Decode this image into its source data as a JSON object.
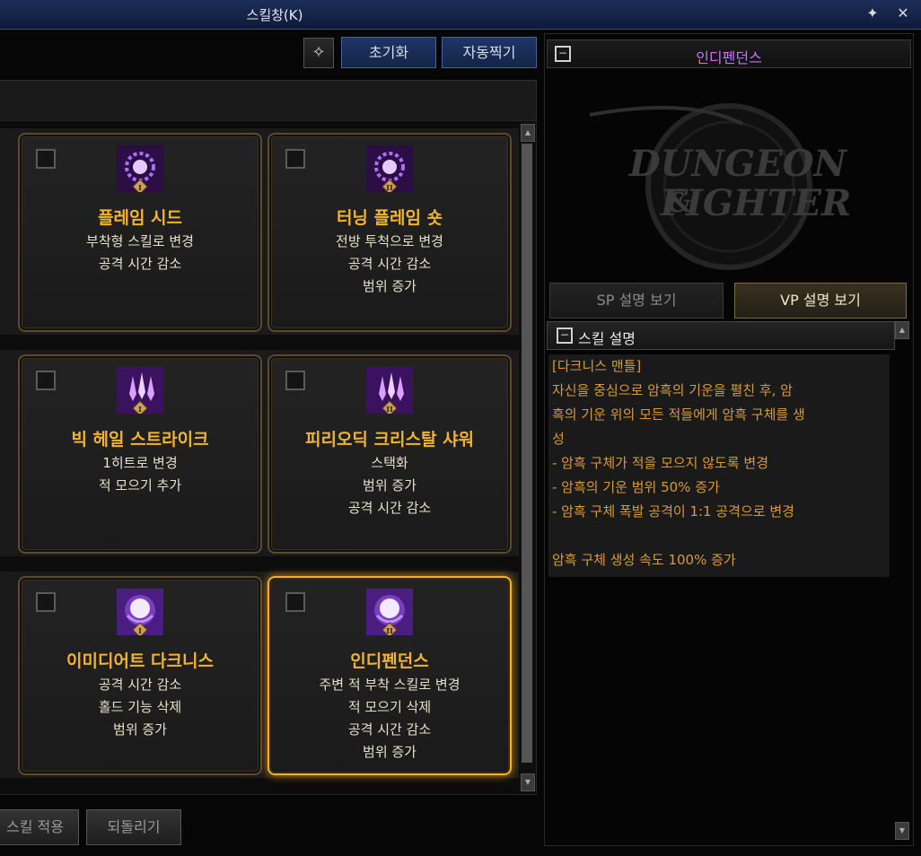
{
  "window": {
    "title": "스킬창(K)"
  },
  "toolbar": {
    "reset_label": "초기화",
    "auto_label": "자동찍기"
  },
  "skills": [
    {
      "name": "플레임 시드",
      "tier": "I",
      "lines": [
        "부착형 스킬로 변경",
        "공격 시간 감소"
      ],
      "icon": "dark-ring-icon"
    },
    {
      "name": "터닝 플레임 숏",
      "tier": "II",
      "lines": [
        "전방 투척으로 변경",
        "공격 시간 감소",
        "범위 증가"
      ],
      "icon": "dark-ring-icon"
    },
    {
      "name": "빅 헤일 스트라이크",
      "tier": "I",
      "lines": [
        "1히트로 변경",
        "적 모으기 추가"
      ],
      "icon": "crystal-shard-icon"
    },
    {
      "name": "피리오딕 크리스탈 샤워",
      "tier": "II",
      "lines": [
        "스택화",
        "범위 증가",
        "공격 시간 감소"
      ],
      "icon": "crystal-shard-icon"
    },
    {
      "name": "이미디어트 다크니스",
      "tier": "I",
      "lines": [
        "공격 시간 감소",
        "홀드 기능 삭제",
        "범위 증가"
      ],
      "icon": "dark-orb-icon"
    },
    {
      "name": "인디펜던스",
      "tier": "II",
      "lines": [
        "주변 적 부착 스킬로 변경",
        "적 모으기 삭제",
        "공격 시간 감소",
        "범위 증가"
      ],
      "icon": "dark-orb-icon",
      "selected": true
    }
  ],
  "bottom": {
    "apply_label": "스킬 적용",
    "revert_label": "되돌리기"
  },
  "right": {
    "header": "인디펜던스",
    "tab_sp": "SP 설명 보기",
    "tab_vp": "VP 설명 보기",
    "desc_header": "스킬 설명",
    "desc_lines": [
      "[다크니스 맨틀]",
      "자신을 중심으로 암흑의 기운을 펼친 후, 암",
      "흑의 기운 위의 모든 적들에게 암흑 구체를 생",
      "성",
      " - 암흑 구체가 적을 모으지 않도록 변경",
      " - 암흑의 기운 범위 50% 증가",
      " - 암흑 구체 폭발 공격이 1:1 공격으로 변경",
      "",
      "암흑 구체 생성 속도 100% 증가"
    ]
  },
  "colors": {
    "accent_gold": "#f0b431",
    "header_purple": "#c773ff",
    "desc_orange": "#d89a3a"
  }
}
